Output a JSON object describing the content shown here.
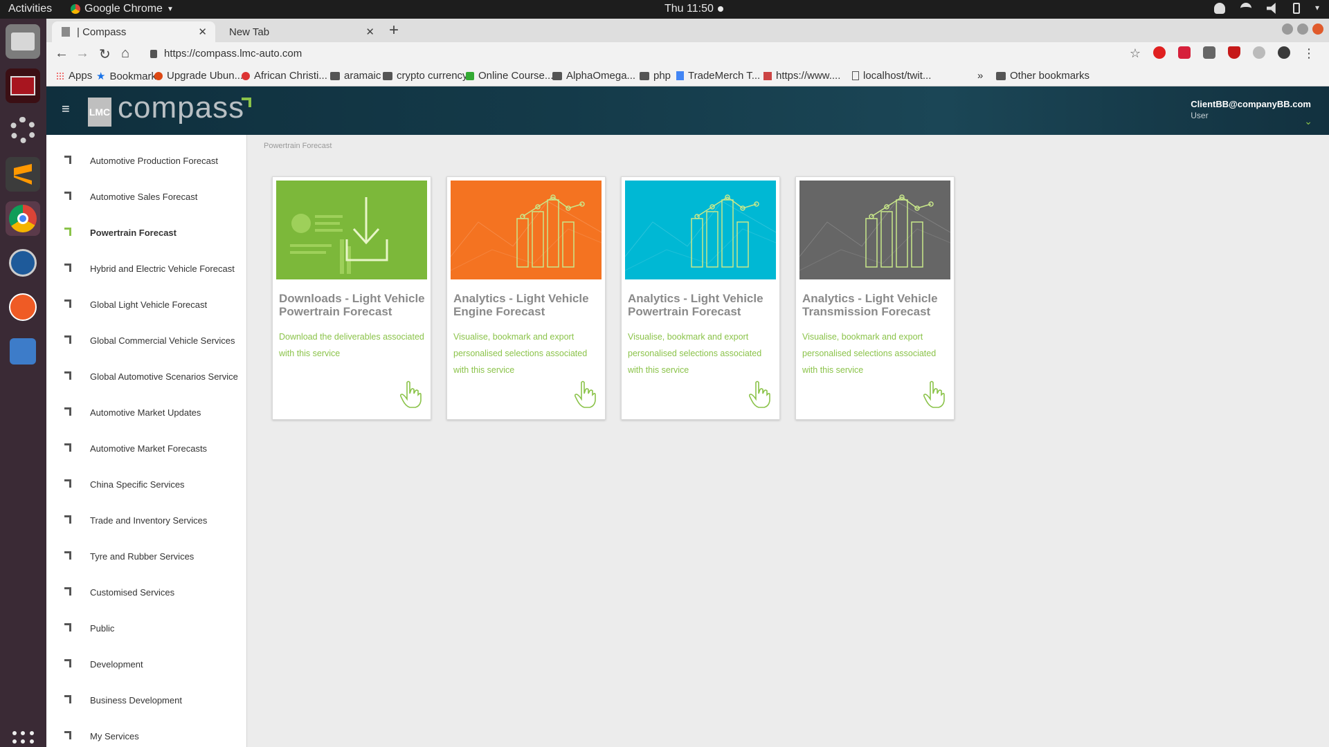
{
  "os": {
    "activities": "Activities",
    "app_name": "Google Chrome",
    "clock": "Thu 11:50"
  },
  "browser": {
    "tabs": [
      {
        "label": "| Compass",
        "active": true
      },
      {
        "label": "New Tab",
        "active": false
      }
    ],
    "url": "https://compass.lmc-auto.com",
    "bookmarks": [
      {
        "label": "Apps"
      },
      {
        "label": "Bookmarks"
      },
      {
        "label": "Upgrade Ubun..."
      },
      {
        "label": "African Christi..."
      },
      {
        "label": "aramaic"
      },
      {
        "label": "crypto currency"
      },
      {
        "label": "Online Course..."
      },
      {
        "label": "AlphaOmega..."
      },
      {
        "label": "php"
      },
      {
        "label": "TradeMerch T..."
      },
      {
        "label": "https://www...."
      },
      {
        "label": "localhost/twit..."
      },
      {
        "label": "»"
      },
      {
        "label": "Other bookmarks"
      }
    ]
  },
  "app": {
    "logo_box": "LMC",
    "logo_text": "compass",
    "user_email": "ClientBB@companyBB.com",
    "user_role": "User",
    "breadcrumb": "Powertrain Forecast",
    "sidebar": [
      {
        "label": "Automotive Production Forecast",
        "active": false
      },
      {
        "label": "Automotive Sales Forecast",
        "active": false
      },
      {
        "label": "Powertrain Forecast",
        "active": true
      },
      {
        "label": "Hybrid and Electric Vehicle Forecast",
        "active": false
      },
      {
        "label": "Global Light Vehicle Forecast",
        "active": false
      },
      {
        "label": "Global Commercial Vehicle Services",
        "active": false
      },
      {
        "label": "Global Automotive Scenarios Service",
        "active": false
      },
      {
        "label": "Automotive Market Updates",
        "active": false
      },
      {
        "label": "Automotive Market Forecasts",
        "active": false
      },
      {
        "label": "China Specific Services",
        "active": false
      },
      {
        "label": "Trade and Inventory Services",
        "active": false
      },
      {
        "label": "Tyre and Rubber Services",
        "active": false
      },
      {
        "label": "Customised Services",
        "active": false
      },
      {
        "label": "Public",
        "active": false
      },
      {
        "label": "Development",
        "active": false
      },
      {
        "label": "Business Development",
        "active": false
      },
      {
        "label": "My Services",
        "active": false
      }
    ],
    "cards": [
      {
        "title": "Downloads - Light Vehicle Powertrain Forecast",
        "desc": "Download the deliverables associated with this service",
        "color": "#7cb83a",
        "kind": "download"
      },
      {
        "title": "Analytics - Light Vehicle Engine Forecast",
        "desc": "Visualise, bookmark and export personalised selections associated with this service",
        "color": "#f47321",
        "kind": "chart"
      },
      {
        "title": "Analytics - Light Vehicle Powertrain Forecast",
        "desc": "Visualise, bookmark and export personalised selections associated with this service",
        "color": "#00b8d4",
        "kind": "chart"
      },
      {
        "title": "Analytics - Light Vehicle Transmission Forecast",
        "desc": "Visualise, bookmark and export personalised selections associated with this service",
        "color": "#666666",
        "kind": "chart"
      }
    ]
  }
}
